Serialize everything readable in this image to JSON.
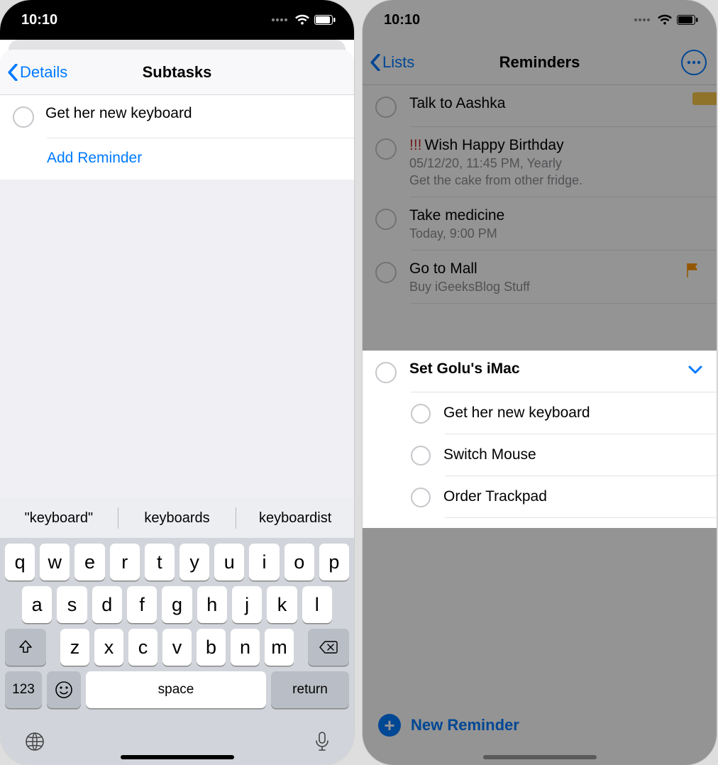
{
  "left": {
    "status_time": "10:10",
    "nav_back": "Details",
    "nav_title": "Subtasks",
    "subtask_title": "Get her new keyboard",
    "add_reminder": "Add Reminder",
    "suggestions": {
      "a": "\"keyboard\"",
      "b": "keyboards",
      "c": "keyboardist"
    },
    "keys": {
      "r1": [
        "q",
        "w",
        "e",
        "r",
        "t",
        "y",
        "u",
        "i",
        "o",
        "p"
      ],
      "r2": [
        "a",
        "s",
        "d",
        "f",
        "g",
        "h",
        "j",
        "k",
        "l"
      ],
      "r3": [
        "z",
        "x",
        "c",
        "v",
        "b",
        "n",
        "m"
      ],
      "num": "123",
      "space": "space",
      "return": "return"
    }
  },
  "right": {
    "status_time": "10:10",
    "nav_back": "Lists",
    "nav_title": "Reminders",
    "items": [
      {
        "title": "Talk to Aashka"
      },
      {
        "priority": "!!!",
        "title": "Wish Happy Birthday",
        "sub1": "05/12/20, 11:45 PM, Yearly",
        "sub2": "Get the cake from other fridge."
      },
      {
        "title": "Take medicine",
        "sub1": "Today, 9:00 PM"
      },
      {
        "title": "Go to Mall",
        "sub1": "Buy iGeeksBlog Stuff"
      }
    ],
    "highlight": {
      "title": "Set Golu's iMac",
      "subtasks": [
        "Get her new keyboard",
        "Switch Mouse",
        "Order Trackpad"
      ]
    },
    "new_reminder": "New Reminder"
  }
}
